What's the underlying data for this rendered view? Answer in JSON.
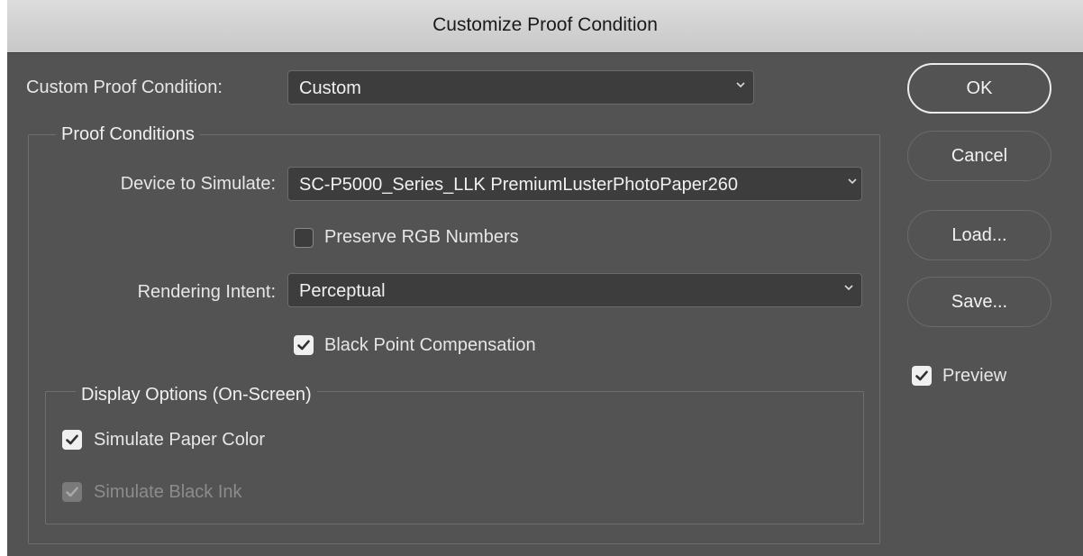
{
  "window": {
    "title": "Customize Proof Condition"
  },
  "custom_condition": {
    "label": "Custom Proof Condition:",
    "value": "Custom"
  },
  "proof_conditions": {
    "group_title": "Proof Conditions",
    "device_label": "Device to Simulate:",
    "device_value": "SC-P5000_Series_LLK PremiumLusterPhotoPaper260",
    "preserve_rgb": {
      "label": "Preserve RGB Numbers",
      "checked": false
    },
    "intent_label": "Rendering Intent:",
    "intent_value": "Perceptual",
    "black_point": {
      "label": "Black Point Compensation",
      "checked": true
    }
  },
  "display_options": {
    "group_title": "Display Options (On-Screen)",
    "paper_color": {
      "label": "Simulate Paper Color",
      "checked": true
    },
    "black_ink": {
      "label": "Simulate Black Ink",
      "checked": true,
      "enabled": false
    }
  },
  "buttons": {
    "ok": "OK",
    "cancel": "Cancel",
    "load": "Load...",
    "save": "Save..."
  },
  "preview": {
    "label": "Preview",
    "checked": true
  },
  "icons": {
    "dropdown": "chevron-down-icon",
    "check": "checkmark-icon"
  },
  "colors": {
    "dialog_bg": "#535353",
    "titlebar_bg": "#d2d2d2",
    "field_bg": "#3d3d3d",
    "text": "#e6e6e6"
  }
}
